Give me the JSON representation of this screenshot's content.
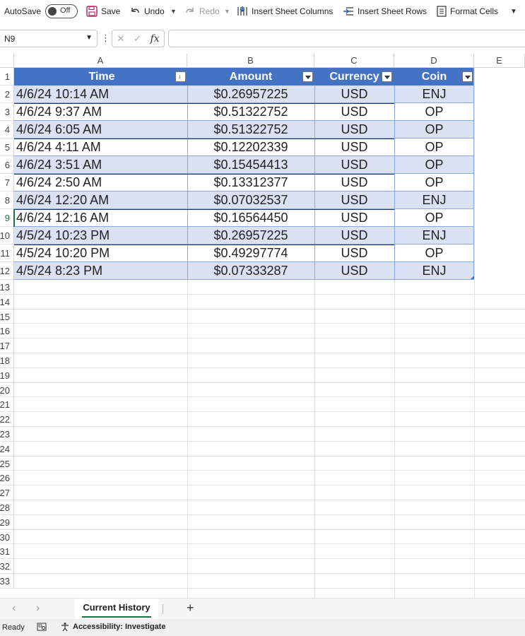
{
  "toolbar": {
    "autosave_label": "AutoSave",
    "autosave_state": "Off",
    "save_label": "Save",
    "undo_label": "Undo",
    "redo_label": "Redo",
    "insert_columns_label": "Insert Sheet Columns",
    "insert_rows_label": "Insert Sheet Rows",
    "format_cells_label": "Format Cells"
  },
  "formula_bar": {
    "name_box": "N9",
    "fx_label": "fx",
    "formula": ""
  },
  "columns": [
    "A",
    "B",
    "C",
    "D",
    "E"
  ],
  "rows": [
    "1",
    "2",
    "3",
    "4",
    "5",
    "6",
    "7",
    "8",
    "9",
    "10",
    "11",
    "12",
    "13",
    "14",
    "15",
    "16",
    "17",
    "18",
    "19",
    "20",
    "21",
    "22",
    "23",
    "24",
    "25",
    "26",
    "27",
    "28",
    "29",
    "30",
    "31",
    "32",
    "33"
  ],
  "table": {
    "headers": [
      "Time",
      "Amount",
      "Currency",
      "Coin"
    ],
    "data": [
      [
        "4/6/24 10:14 AM",
        "$0.26957225",
        "USD",
        "ENJ"
      ],
      [
        "4/6/24 9:37 AM",
        "$0.51322752",
        "USD",
        "OP"
      ],
      [
        "4/6/24 6:05 AM",
        "$0.51322752",
        "USD",
        "OP"
      ],
      [
        "4/6/24 4:11 AM",
        "$0.12202339",
        "USD",
        "OP"
      ],
      [
        "4/6/24 3:51 AM",
        "$0.15454413",
        "USD",
        "OP"
      ],
      [
        "4/6/24 2:50 AM",
        "$0.13312377",
        "USD",
        "OP"
      ],
      [
        "4/6/24 12:20 AM",
        "$0.07032537",
        "USD",
        "ENJ"
      ],
      [
        "4/6/24 12:16 AM",
        "$0.16564450",
        "USD",
        "OP"
      ],
      [
        "4/5/24 10:23 PM",
        "$0.26957225",
        "USD",
        "ENJ"
      ],
      [
        "4/5/24 10:20 PM",
        "$0.49297774",
        "USD",
        "OP"
      ],
      [
        "4/5/24 8:23 PM",
        "$0.07333287",
        "USD",
        "ENJ"
      ]
    ],
    "header_color": "#4472c4",
    "band_color": "#d9e1f2"
  },
  "sheet_tabs": {
    "active": "Current History",
    "add_label": "+"
  },
  "status_bar": {
    "ready": "Ready",
    "accessibility": "Accessibility: Investigate"
  }
}
